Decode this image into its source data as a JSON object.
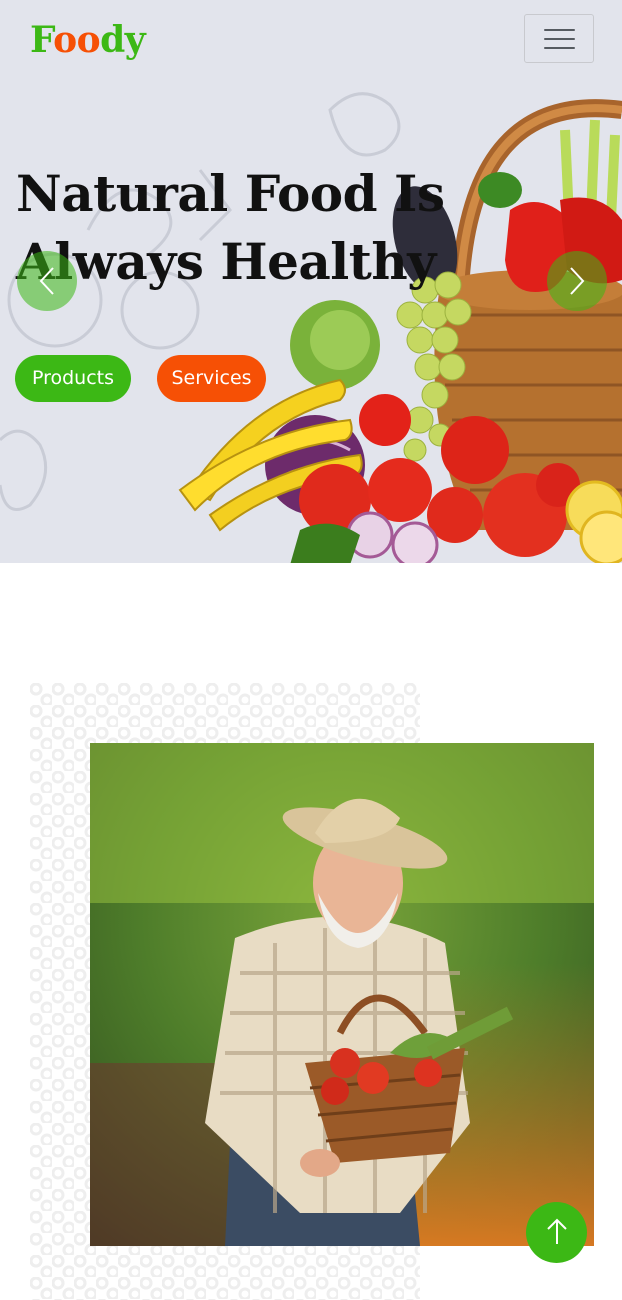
{
  "brand": {
    "letters": [
      "F",
      "o",
      "o",
      "d",
      "y"
    ]
  },
  "nav": {
    "toggle_icon": "hamburger-icon"
  },
  "hero": {
    "title_line1": "Natural Food Is",
    "title_line2": "Always Healthy",
    "products_label": "Products",
    "services_label": "Services",
    "prev_icon": "chevron-left-icon",
    "next_icon": "chevron-right-icon"
  },
  "about": {
    "image": "farmer-with-vegetable-basket"
  },
  "back_to_top": {
    "icon": "arrow-up-icon"
  },
  "colors": {
    "primary": "#3cb815",
    "secondary": "#f65005",
    "hero_bg": "#e2e4ec",
    "text_dark": "#111111"
  }
}
